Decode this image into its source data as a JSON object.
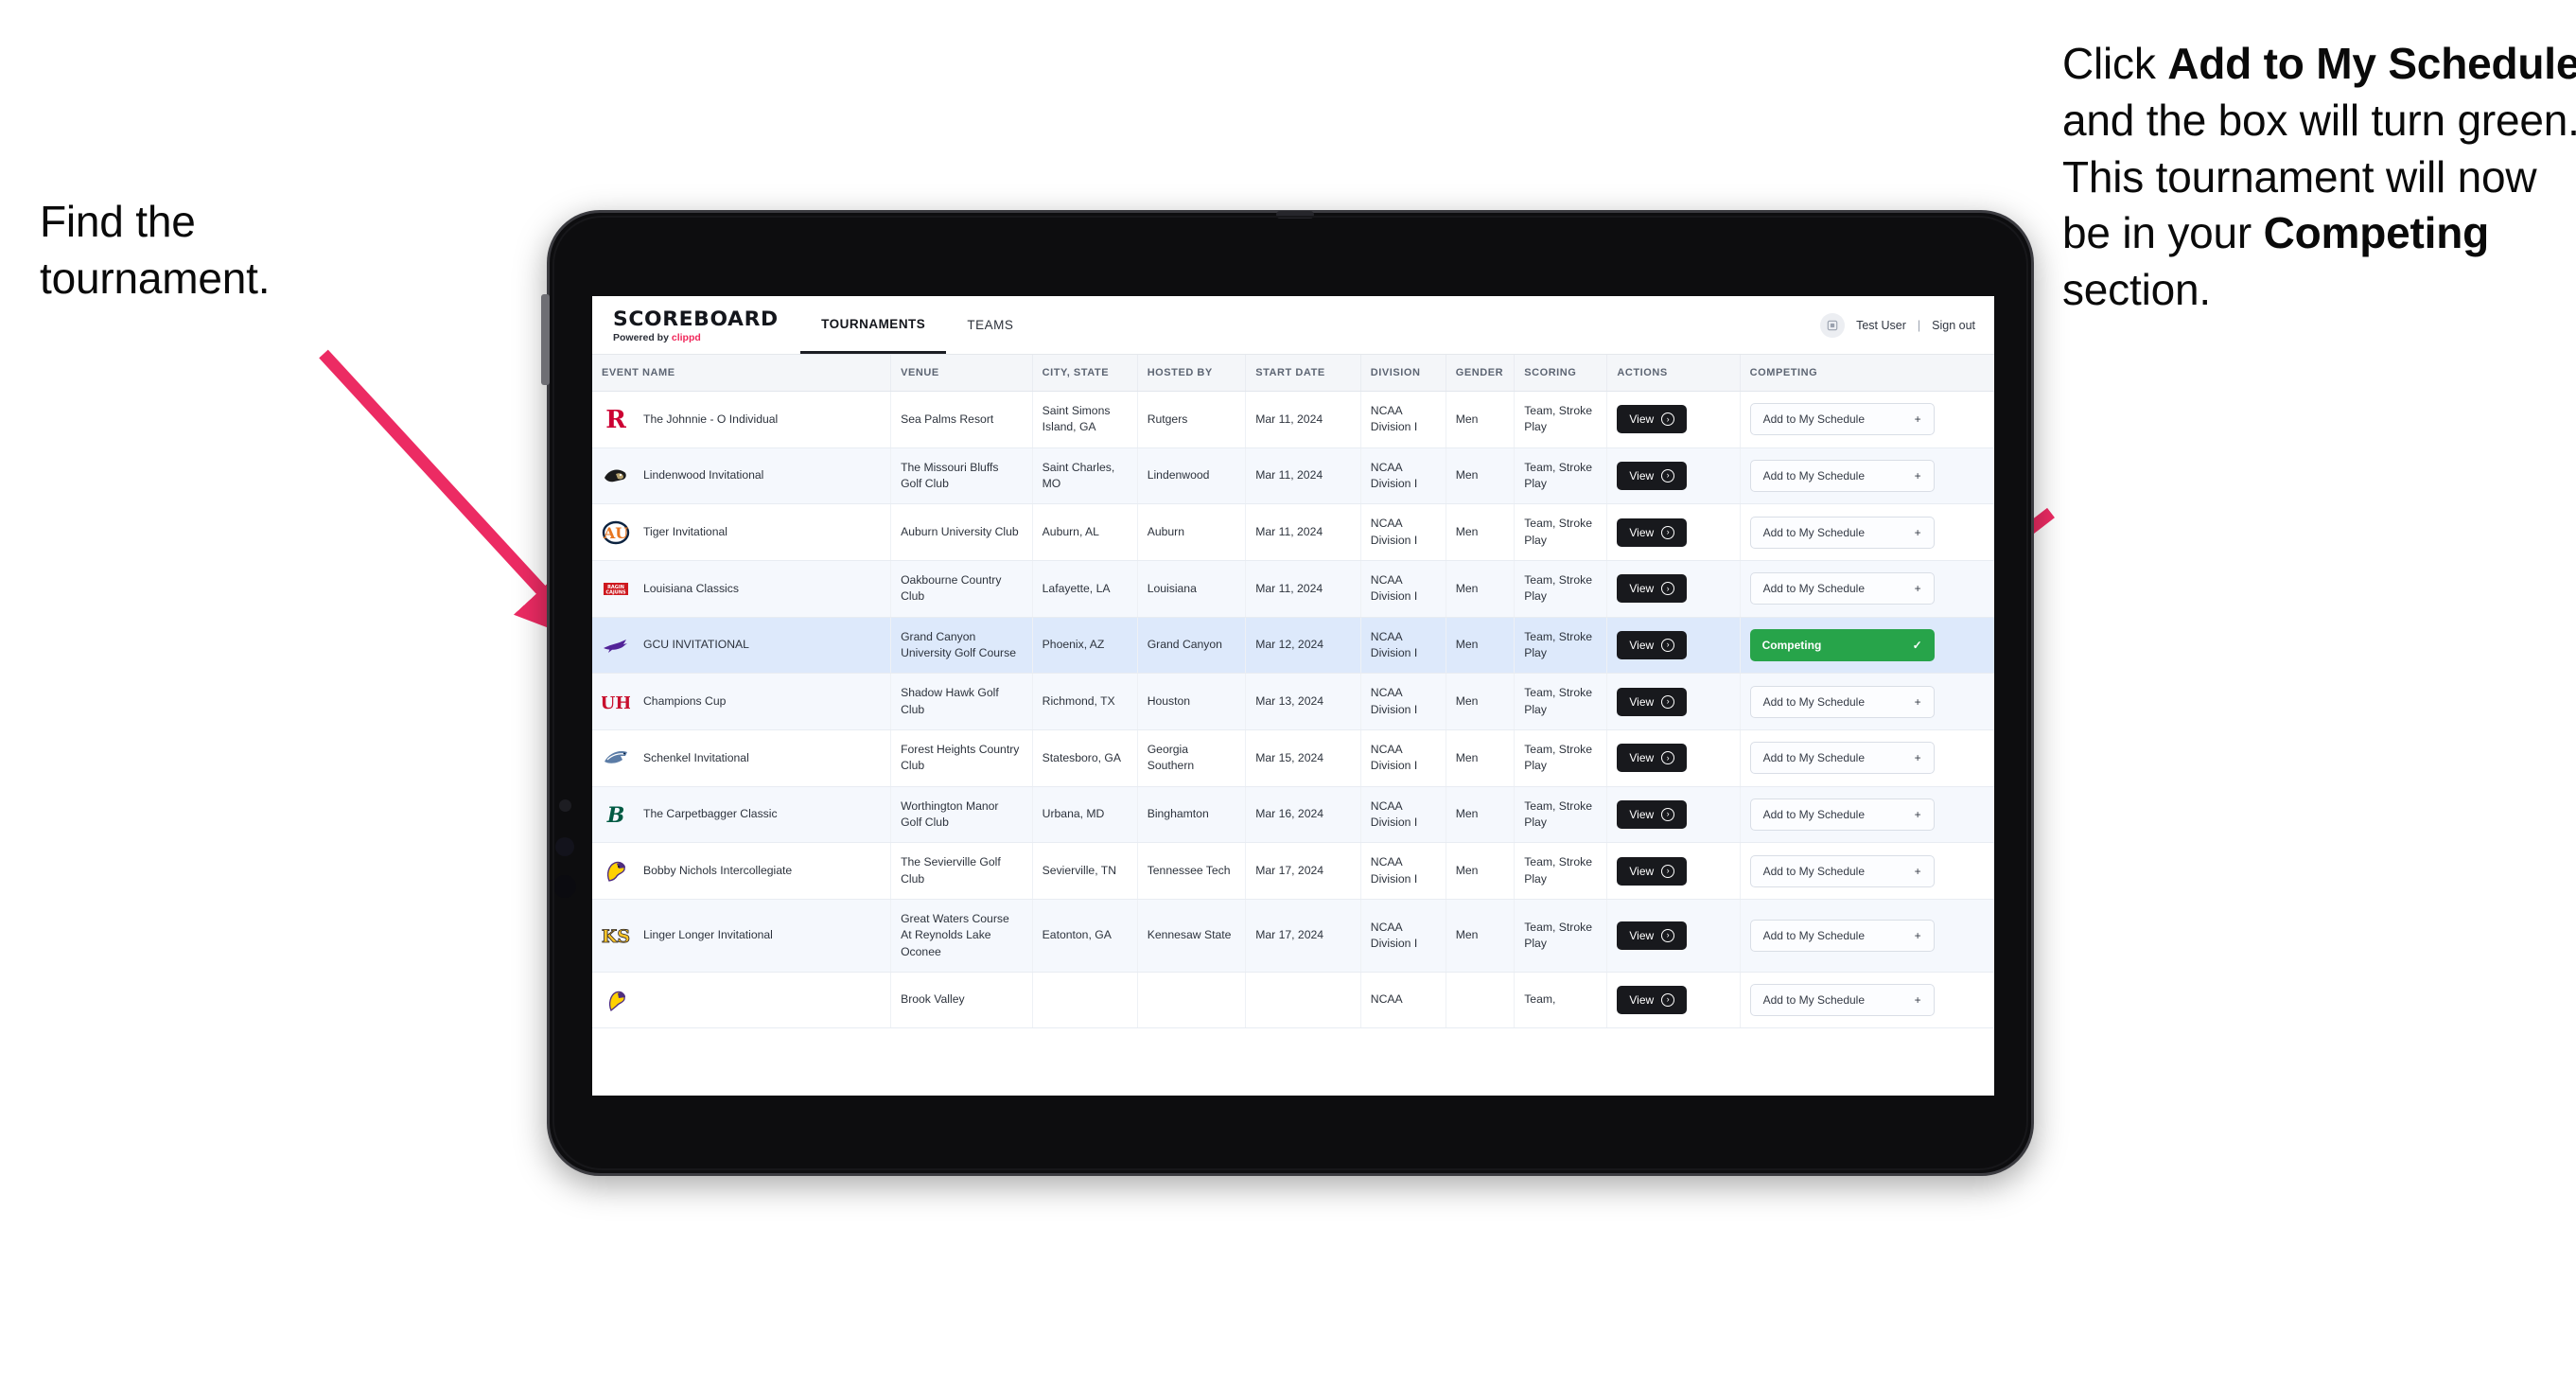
{
  "annotations": {
    "left": {
      "line1": "Find the",
      "line2": "tournament."
    },
    "right": {
      "part1": "Click ",
      "bold1": "Add to My Schedule",
      "part2": " and the box will turn green. This tournament will now be in your ",
      "bold2": "Competing",
      "part3": " section."
    },
    "arrow_color": "#ec2b63"
  },
  "app": {
    "brand": {
      "title": "SCOREBOARD",
      "powered_prefix": "Powered by ",
      "powered_name": "clippd"
    },
    "tabs": [
      {
        "label": "TOURNAMENTS",
        "active": true
      },
      {
        "label": "TEAMS",
        "active": false
      }
    ],
    "user": {
      "avatar_icon": "user-avatar-icon",
      "name": "Test User",
      "separator": "|",
      "signout": "Sign out"
    },
    "table": {
      "columns": [
        "EVENT NAME",
        "VENUE",
        "CITY, STATE",
        "HOSTED BY",
        "START DATE",
        "DIVISION",
        "GENDER",
        "SCORING",
        "ACTIONS",
        "COMPETING"
      ],
      "action_label": "View",
      "action_icon": "arrow-right-circle-icon",
      "add_label": "Add to My Schedule",
      "add_icon": "plus-icon",
      "competing_label": "Competing",
      "competing_icon": "check-icon",
      "competing_color": "#27a44a",
      "rows": [
        {
          "logo": "rutgers-r-logo",
          "event": "The Johnnie - O Individual",
          "venue": "Sea Palms Resort",
          "city": "Saint Simons Island, GA",
          "host": "Rutgers",
          "date": "Mar 11, 2024",
          "division": "NCAA Division I",
          "gender": "Men",
          "scoring": "Team, Stroke Play",
          "competing": false
        },
        {
          "logo": "lindenwood-lion-logo",
          "event": "Lindenwood Invitational",
          "venue": "The Missouri Bluffs Golf Club",
          "city": "Saint Charles, MO",
          "host": "Lindenwood",
          "date": "Mar 11, 2024",
          "division": "NCAA Division I",
          "gender": "Men",
          "scoring": "Team, Stroke Play",
          "competing": false
        },
        {
          "logo": "auburn-au-logo",
          "event": "Tiger Invitational",
          "venue": "Auburn University Club",
          "city": "Auburn, AL",
          "host": "Auburn",
          "date": "Mar 11, 2024",
          "division": "NCAA Division I",
          "gender": "Men",
          "scoring": "Team, Stroke Play",
          "competing": false
        },
        {
          "logo": "louisiana-ragin-cajuns-logo",
          "event": "Louisiana Classics",
          "venue": "Oakbourne Country Club",
          "city": "Lafayette, LA",
          "host": "Louisiana",
          "date": "Mar 11, 2024",
          "division": "NCAA Division I",
          "gender": "Men",
          "scoring": "Team, Stroke Play",
          "competing": false
        },
        {
          "logo": "gcu-lopes-logo",
          "event": "GCU INVITATIONAL",
          "venue": "Grand Canyon University Golf Course",
          "city": "Phoenix, AZ",
          "host": "Grand Canyon",
          "date": "Mar 12, 2024",
          "division": "NCAA Division I",
          "gender": "Men",
          "scoring": "Team, Stroke Play",
          "competing": true,
          "selected": true
        },
        {
          "logo": "houston-uh-logo",
          "event": "Champions Cup",
          "venue": "Shadow Hawk Golf Club",
          "city": "Richmond, TX",
          "host": "Houston",
          "date": "Mar 13, 2024",
          "division": "NCAA Division I",
          "gender": "Men",
          "scoring": "Team, Stroke Play",
          "competing": false
        },
        {
          "logo": "georgia-southern-eagle-logo",
          "event": "Schenkel Invitational",
          "venue": "Forest Heights Country Club",
          "city": "Statesboro, GA",
          "host": "Georgia Southern",
          "date": "Mar 15, 2024",
          "division": "NCAA Division I",
          "gender": "Men",
          "scoring": "Team, Stroke Play",
          "competing": false
        },
        {
          "logo": "binghamton-b-logo",
          "event": "The Carpetbagger Classic",
          "venue": "Worthington Manor Golf Club",
          "city": "Urbana, MD",
          "host": "Binghamton",
          "date": "Mar 16, 2024",
          "division": "NCAA Division I",
          "gender": "Men",
          "scoring": "Team, Stroke Play",
          "competing": false
        },
        {
          "logo": "tennessee-tech-eagle-logo",
          "event": "Bobby Nichols Intercollegiate",
          "venue": "The Sevierville Golf Club",
          "city": "Sevierville, TN",
          "host": "Tennessee Tech",
          "date": "Mar 17, 2024",
          "division": "NCAA Division I",
          "gender": "Men",
          "scoring": "Team, Stroke Play",
          "competing": false
        },
        {
          "logo": "kennesaw-state-ks-logo",
          "event": "Linger Longer Invitational",
          "venue": "Great Waters Course At Reynolds Lake Oconee",
          "city": "Eatonton, GA",
          "host": "Kennesaw State",
          "date": "Mar 17, 2024",
          "division": "NCAA Division I",
          "gender": "Men",
          "scoring": "Team, Stroke Play",
          "competing": false
        },
        {
          "logo": "east-carolina-logo",
          "event": "",
          "venue": "Brook Valley",
          "city": "",
          "host": "",
          "date": "",
          "division": "NCAA",
          "gender": "",
          "scoring": "Team,",
          "competing": false,
          "partial": true
        }
      ]
    }
  }
}
